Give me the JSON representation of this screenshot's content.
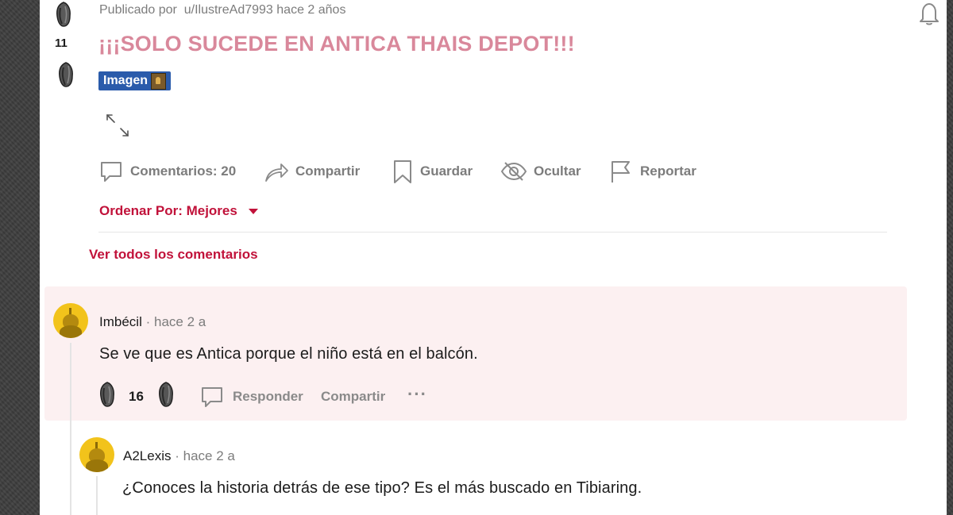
{
  "post": {
    "score": "11",
    "meta_prefix": "Publicado por",
    "author": "u/IlustreAd7993",
    "time": "hace 2 años",
    "title": "¡¡¡SOLO SUCEDE EN ANTICA THAIS DEPOT!!!",
    "flair": "Imagen"
  },
  "actions": {
    "comments": "Comentarios: 20",
    "share": "Compartir",
    "save": "Guardar",
    "hide": "Ocultar",
    "report": "Reportar"
  },
  "sort": {
    "label": "Ordenar Por: Mejores"
  },
  "view_all": "Ver todos los comentarios",
  "comments": [
    {
      "author": "Imbécil",
      "separator": "·",
      "time": "hace 2 a",
      "body": "Se ve que es Antica porque el niño está en el balcón.",
      "score": "16",
      "reply": "Responder",
      "share": "Compartir",
      "more": "···"
    },
    {
      "author": "A2Lexis",
      "separator": "·",
      "time": "hace 2 a",
      "body": "¿Conoces la historia detrás de ese tipo? Es el más buscado en Tibiaring."
    }
  ],
  "colors": {
    "accent": "#c1123a",
    "title": "#d9889b",
    "flair_bg": "#2a5bab",
    "highlight_bg": "#fcf0f1",
    "avatar": "#f2c31b"
  },
  "icons": {
    "upvote": "upvote-stone-icon",
    "downvote": "downvote-stone-icon",
    "expand": "expand-arrows-icon",
    "comment": "comment-bubble-icon",
    "share": "share-arrow-icon",
    "save": "bookmark-icon",
    "hide": "eye-slash-icon",
    "report": "flag-icon",
    "bell": "bell-icon"
  }
}
